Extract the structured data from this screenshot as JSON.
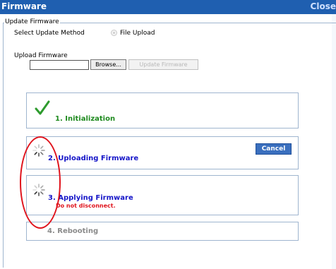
{
  "window": {
    "title": "Firmware",
    "close_label": "Close"
  },
  "update_section": {
    "legend": "Update Firmware",
    "method_label": "Select Update Method",
    "method_option": "File Upload",
    "upload_label": "Upload Firmware",
    "file_value": "",
    "browse_label": "Browse...",
    "update_label": "Update Firmware"
  },
  "steps": [
    {
      "label": "1. Initialization",
      "status": "complete",
      "color": "#1e8a1e"
    },
    {
      "label": "2. Uploading Firmware",
      "status": "in-progress",
      "color": "#1515c8"
    },
    {
      "label": "3. Applying Firmware",
      "status": "in-progress",
      "color": "#1515c8",
      "note": "Do not disconnect."
    },
    {
      "label": "4. Rebooting",
      "status": "pending",
      "color": "#8a8a8a"
    }
  ],
  "cancel_label": "Cancel",
  "colors": {
    "title_bar": "#1f5fb0",
    "note": "#e0141d",
    "annotation": "#e0141d"
  }
}
